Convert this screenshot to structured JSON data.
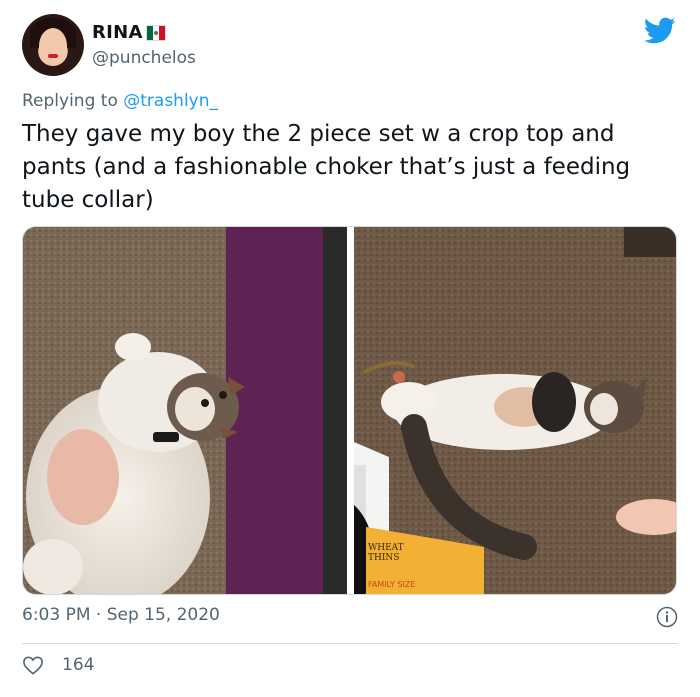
{
  "author": {
    "display_name": "RINA",
    "handle": "@punchelos",
    "flag_colors": [
      "#006847",
      "#ffffff",
      "#ce1126"
    ]
  },
  "reply": {
    "prefix": "Replying to ",
    "mention": "@trashlyn_"
  },
  "tweet": {
    "text": "They gave my boy the 2 piece set w a crop top and pants (and a fashionable choker that’s just a feeding tube collar)"
  },
  "media": {
    "images": [
      {
        "name": "photo-left",
        "description_icon": "cat-photo"
      },
      {
        "name": "photo-right",
        "description_icon": "cat-photo"
      }
    ],
    "box_text": [
      "WHEAT",
      "THINS",
      "FAMILY SIZE"
    ]
  },
  "meta": {
    "timestamp": "6:03 PM · Sep 15, 2020",
    "likes": "164"
  },
  "colors": {
    "twitter_blue": "#1d9bf0",
    "secondary_text": "#536471",
    "border": "#cfd9de"
  },
  "icons": {
    "brand": "twitter-bird-icon",
    "info": "info-icon",
    "like": "heart-icon"
  }
}
